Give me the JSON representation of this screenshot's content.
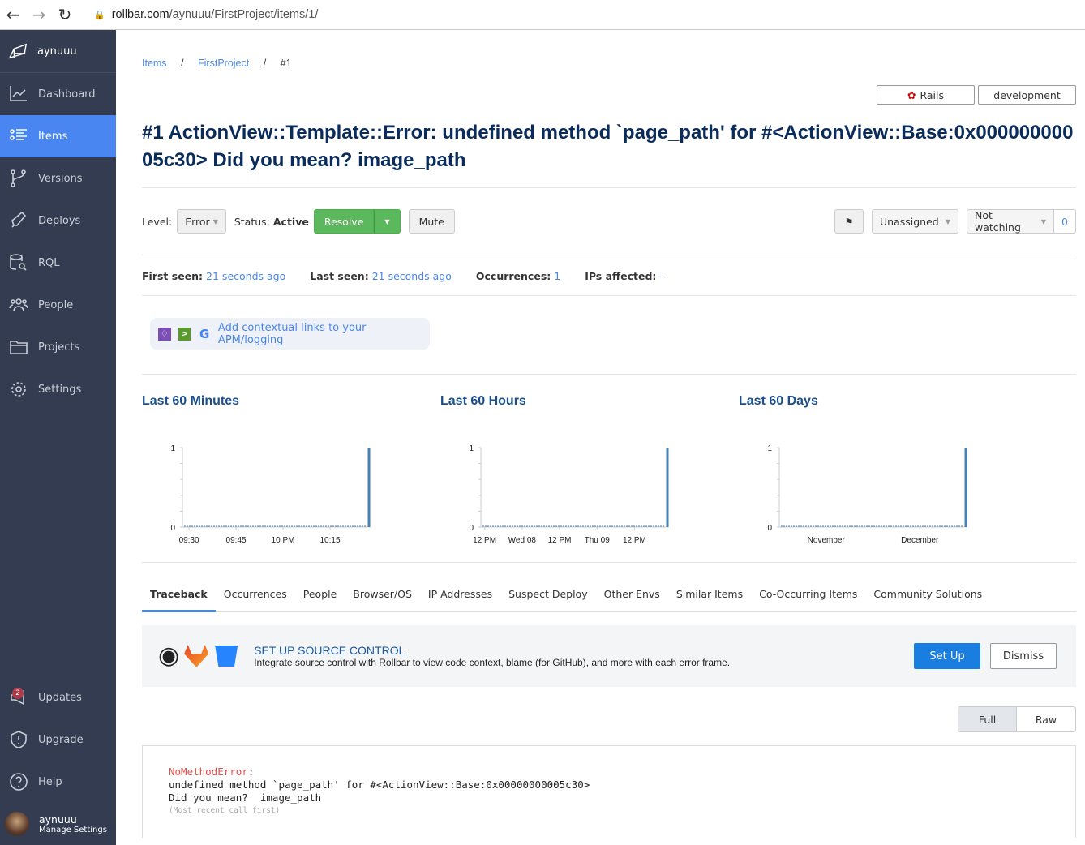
{
  "browser": {
    "url_host": "rollbar.com",
    "url_path": "/aynuuu/FirstProject/items/1/"
  },
  "sidebar": {
    "account": "aynuuu",
    "items": [
      {
        "label": "Dashboard",
        "icon": "chart-line-icon"
      },
      {
        "label": "Items",
        "icon": "list-icon",
        "active": true
      },
      {
        "label": "Versions",
        "icon": "git-branch-icon"
      },
      {
        "label": "Deploys",
        "icon": "rocket-icon"
      },
      {
        "label": "RQL",
        "icon": "database-search-icon"
      },
      {
        "label": "People",
        "icon": "people-icon"
      },
      {
        "label": "Projects",
        "icon": "folder-icon"
      },
      {
        "label": "Settings",
        "icon": "gear-icon"
      }
    ],
    "bottom": [
      {
        "label": "Updates",
        "icon": "megaphone-icon",
        "badge": "2"
      },
      {
        "label": "Upgrade",
        "icon": "shield-alert-icon"
      },
      {
        "label": "Help",
        "icon": "help-icon"
      }
    ],
    "user": {
      "name": "aynuuu",
      "sub": "Manage Settings"
    }
  },
  "breadcrumb": {
    "items": "Items",
    "project": "FirstProject",
    "current": "#1",
    "sep": "/"
  },
  "env": {
    "framework": "Rails",
    "environment": "development"
  },
  "title": "#1 ActionView::Template::Error: undefined method `page_path' for #<ActionView::Base:0x00000000005c30> Did you mean? image_path",
  "controls": {
    "level_label": "Level:",
    "level": "Error",
    "status_label": "Status:",
    "status": "Active",
    "resolve": "Resolve",
    "mute": "Mute",
    "assignee": "Unassigned",
    "watch": "Not watching",
    "watch_count": "0"
  },
  "stats": {
    "first_seen_label": "First seen:",
    "first_seen": "21 seconds ago",
    "last_seen_label": "Last seen:",
    "last_seen": "21 seconds ago",
    "occurrences_label": "Occurrences:",
    "occurrences": "1",
    "ips_label": "IPs affected:",
    "ips": "-"
  },
  "apm": {
    "text": "Add contextual links to your APM/logging"
  },
  "chart_data": [
    {
      "type": "line",
      "title": "Last 60 Minutes",
      "ylim": [
        0,
        1
      ],
      "yticks": [
        "0",
        "1"
      ],
      "xticks": [
        "09:30",
        "09:45",
        "10 PM",
        "10:15"
      ],
      "series": [
        {
          "values": [
            0,
            0,
            0,
            0,
            0,
            0,
            0,
            0,
            0,
            0,
            0,
            0,
            0,
            0,
            0,
            0,
            0,
            0,
            0,
            0,
            0,
            0,
            0,
            0,
            0,
            0,
            0,
            0,
            0,
            0,
            0,
            0,
            0,
            0,
            0,
            0,
            0,
            0,
            0,
            0,
            0,
            0,
            0,
            0,
            0,
            0,
            0,
            0,
            0,
            0,
            0,
            0,
            0,
            0,
            0,
            0,
            0,
            0,
            0,
            1
          ]
        }
      ],
      "color": "#4682b4"
    },
    {
      "type": "line",
      "title": "Last 60 Hours",
      "ylim": [
        0,
        1
      ],
      "yticks": [
        "0",
        "1"
      ],
      "xticks": [
        "12 PM",
        "Wed 08",
        "12 PM",
        "Thu 09",
        "12 PM"
      ],
      "series": [
        {
          "values": [
            0,
            0,
            0,
            0,
            0,
            0,
            0,
            0,
            0,
            0,
            0,
            0,
            0,
            0,
            0,
            0,
            0,
            0,
            0,
            0,
            0,
            0,
            0,
            0,
            0,
            0,
            0,
            0,
            0,
            0,
            0,
            0,
            0,
            0,
            0,
            0,
            0,
            0,
            0,
            0,
            0,
            0,
            0,
            0,
            0,
            0,
            0,
            0,
            0,
            0,
            0,
            0,
            0,
            0,
            0,
            0,
            0,
            0,
            0,
            1
          ]
        }
      ],
      "color": "#4682b4"
    },
    {
      "type": "line",
      "title": "Last 60 Days",
      "ylim": [
        0,
        1
      ],
      "yticks": [
        "0",
        "1"
      ],
      "xticks": [
        "November",
        "December"
      ],
      "series": [
        {
          "values": [
            0,
            0,
            0,
            0,
            0,
            0,
            0,
            0,
            0,
            0,
            0,
            0,
            0,
            0,
            0,
            0,
            0,
            0,
            0,
            0,
            0,
            0,
            0,
            0,
            0,
            0,
            0,
            0,
            0,
            0,
            0,
            0,
            0,
            0,
            0,
            0,
            0,
            0,
            0,
            0,
            0,
            0,
            0,
            0,
            0,
            0,
            0,
            0,
            0,
            0,
            0,
            0,
            0,
            0,
            0,
            0,
            0,
            0,
            0,
            1
          ]
        }
      ],
      "color": "#4682b4"
    }
  ],
  "tabs": [
    "Traceback",
    "Occurrences",
    "People",
    "Browser/OS",
    "IP Addresses",
    "Suspect Deploy",
    "Other Envs",
    "Similar Items",
    "Co-Occurring Items",
    "Community Solutions"
  ],
  "scm": {
    "title": "SET UP SOURCE CONTROL",
    "desc": "Integrate source control with Rollbar to view code context, blame (for GitHub), and more with each error frame.",
    "setup": "Set Up",
    "dismiss": "Dismiss"
  },
  "view": {
    "full": "Full",
    "raw": "Raw"
  },
  "trace": {
    "error_class": "NoMethodError",
    "colon": ":",
    "line1": "undefined method `page_path' for #<ActionView::Base:0x00000000005c30>",
    "line2": "Did you mean?  image_path",
    "note": "(Most recent call first)"
  }
}
